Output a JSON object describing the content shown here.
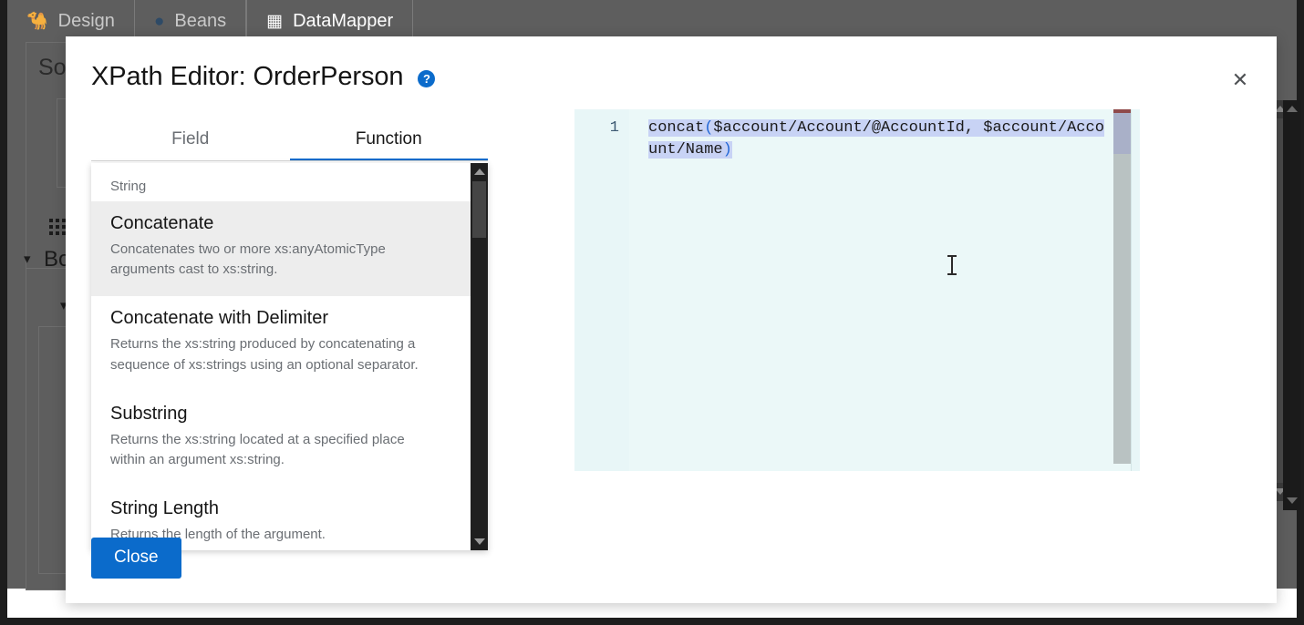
{
  "app": {
    "tabs": [
      {
        "label": "Design",
        "icon": "camel-icon",
        "active": false
      },
      {
        "label": "Beans",
        "icon": "beans-icon",
        "active": false
      },
      {
        "label": "DataMapper",
        "icon": "datamapper-icon",
        "active": true
      }
    ],
    "panels": {
      "source_label": "Sou",
      "body_label": "Boc"
    }
  },
  "modal": {
    "title": "XPath Editor: OrderPerson",
    "help_icon": "question-circle-icon",
    "close_icon": "close-icon",
    "close_button_label": "Close",
    "tabs": [
      {
        "label": "Field",
        "active": false
      },
      {
        "label": "Function",
        "active": true
      }
    ],
    "function_list": {
      "group_label": "String",
      "items": [
        {
          "name": "Concatenate",
          "description": "Concatenates two or more xs:anyAtomicType arguments cast to xs:string.",
          "selected": true
        },
        {
          "name": "Concatenate with Delimiter",
          "description": "Returns the xs:string produced by concatenating a sequence of xs:strings using an optional separator.",
          "selected": false
        },
        {
          "name": "Substring",
          "description": "Returns the xs:string located at a specified place within an argument xs:string.",
          "selected": false
        },
        {
          "name": "String Length",
          "description": "Returns the length of the argument.",
          "selected": false
        }
      ]
    },
    "editor": {
      "line_number": "1",
      "code_before_paren": "concat",
      "code_open_paren": "(",
      "code_body": "$account/Account/@AccountId, $account/Account/Name",
      "code_close_paren": ")",
      "full_expression": "concat($account/Account/@AccountId, $account/Account/Name)"
    }
  },
  "colors": {
    "accent": "#0b6bcb",
    "editor_bg": "#ebf8f8",
    "selection": "#c8d3f5",
    "paren": "#2167d6",
    "list_selected": "#ededed"
  }
}
